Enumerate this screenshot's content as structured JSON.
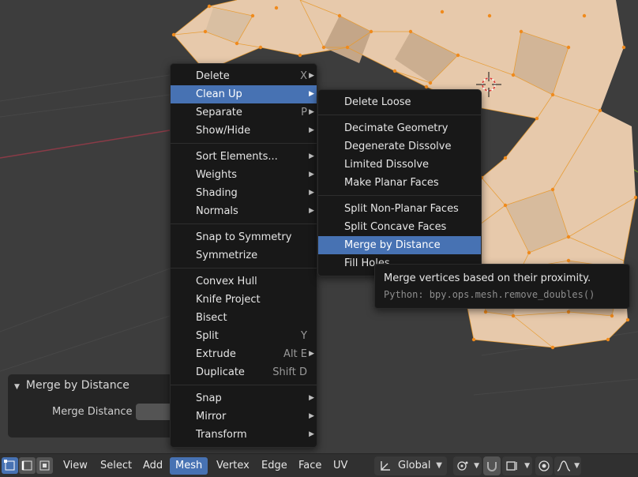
{
  "mesh_menu": {
    "items": [
      {
        "label": "Delete",
        "shortcut": "X",
        "submenu": true
      },
      {
        "label": "Clean Up",
        "shortcut": "",
        "submenu": true,
        "active": true
      },
      {
        "label": "Separate",
        "shortcut": "P",
        "submenu": true
      },
      {
        "label": "Show/Hide",
        "shortcut": "",
        "submenu": true
      },
      {
        "label": "Sort Elements...",
        "shortcut": "",
        "submenu": true
      },
      {
        "label": "Weights",
        "shortcut": "",
        "submenu": true
      },
      {
        "label": "Shading",
        "shortcut": "",
        "submenu": true
      },
      {
        "label": "Normals",
        "shortcut": "",
        "submenu": true
      },
      {
        "label": "Snap to Symmetry",
        "shortcut": "",
        "submenu": false
      },
      {
        "label": "Symmetrize",
        "shortcut": "",
        "submenu": false
      },
      {
        "label": "Convex Hull",
        "shortcut": "",
        "submenu": false
      },
      {
        "label": "Knife Project",
        "shortcut": "",
        "submenu": false
      },
      {
        "label": "Bisect",
        "shortcut": "",
        "submenu": false
      },
      {
        "label": "Split",
        "shortcut": "Y",
        "submenu": false
      },
      {
        "label": "Extrude",
        "shortcut": "Alt E",
        "submenu": true
      },
      {
        "label": "Duplicate",
        "shortcut": "Shift D",
        "submenu": false
      },
      {
        "label": "Snap",
        "shortcut": "",
        "submenu": true
      },
      {
        "label": "Mirror",
        "shortcut": "",
        "submenu": true
      },
      {
        "label": "Transform",
        "shortcut": "",
        "submenu": true
      }
    ]
  },
  "cleanup_menu": {
    "items": [
      {
        "label": "Delete Loose"
      },
      {
        "label": "Decimate Geometry"
      },
      {
        "label": "Degenerate Dissolve"
      },
      {
        "label": "Limited Dissolve"
      },
      {
        "label": "Make Planar Faces"
      },
      {
        "label": "Split Non-Planar Faces"
      },
      {
        "label": "Split Concave Faces"
      },
      {
        "label": "Merge by Distance",
        "active": true
      },
      {
        "label": "Fill Holes"
      }
    ]
  },
  "tooltip": {
    "description": "Merge vertices based on their proximity.",
    "python": "Python: bpy.ops.mesh.remove_doubles()"
  },
  "redo_panel": {
    "title": "Merge by Distance",
    "field_label": "Merge Distance"
  },
  "header": {
    "menus": [
      "View",
      "Select",
      "Add",
      "Mesh",
      "Vertex",
      "Edge",
      "Face",
      "UV"
    ],
    "active_menu": "Mesh",
    "transform_orientation": "Global"
  },
  "colors": {
    "accent": "#4772b3",
    "menu_bg": "#181818",
    "mesh_face": "#e7c9ab",
    "mesh_edge": "#e89a2e"
  }
}
